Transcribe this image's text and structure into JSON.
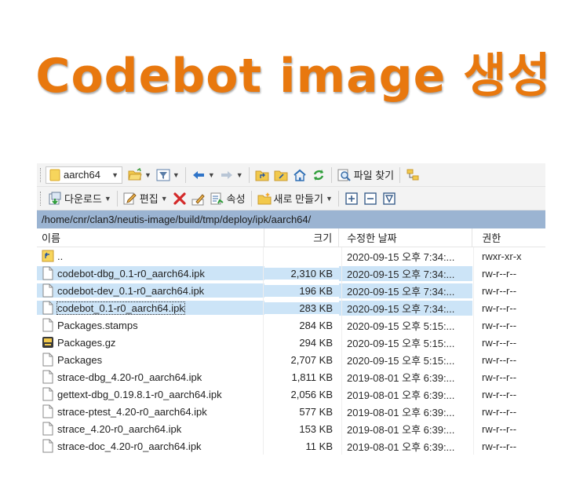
{
  "slide": {
    "title": "Codebot image 생성"
  },
  "toolbar1": {
    "folder": "aarch64",
    "find_files": "파일 찾기"
  },
  "toolbar2": {
    "download": "다운로드",
    "edit": "편집",
    "properties": "속성",
    "new": "새로 만들기"
  },
  "path": "/home/cnr/clan3/neutis-image/build/tmp/deploy/ipk/aarch64/",
  "columns": {
    "name": "이름",
    "size": "크기",
    "date": "수정한 날짜",
    "perm": "권한"
  },
  "files": [
    {
      "name": "..",
      "size": "",
      "date": "2020-09-15 오후 7:34:...",
      "perm": "rwxr-xr-x",
      "icon": "parent-dir-icon"
    },
    {
      "name": "codebot-dbg_0.1-r0_aarch64.ipk",
      "size": "2,310 KB",
      "date": "2020-09-15 오후 7:34:...",
      "perm": "rw-r--r--",
      "icon": "file-icon"
    },
    {
      "name": "codebot-dev_0.1-r0_aarch64.ipk",
      "size": "196 KB",
      "date": "2020-09-15 오후 7:34:...",
      "perm": "rw-r--r--",
      "icon": "file-icon"
    },
    {
      "name": "codebot_0.1-r0_aarch64.ipk",
      "size": "283 KB",
      "date": "2020-09-15 오후 7:34:...",
      "perm": "rw-r--r--",
      "icon": "file-icon"
    },
    {
      "name": "Packages.stamps",
      "size": "284 KB",
      "date": "2020-09-15 오후 5:15:...",
      "perm": "rw-r--r--",
      "icon": "file-icon"
    },
    {
      "name": "Packages.gz",
      "size": "294 KB",
      "date": "2020-09-15 오후 5:15:...",
      "perm": "rw-r--r--",
      "icon": "gz-archive-icon"
    },
    {
      "name": "Packages",
      "size": "2,707 KB",
      "date": "2020-09-15 오후 5:15:...",
      "perm": "rw-r--r--",
      "icon": "file-icon"
    },
    {
      "name": "strace-dbg_4.20-r0_aarch64.ipk",
      "size": "1,811 KB",
      "date": "2019-08-01 오후 6:39:...",
      "perm": "rw-r--r--",
      "icon": "file-icon"
    },
    {
      "name": "gettext-dbg_0.19.8.1-r0_aarch64.ipk",
      "size": "2,056 KB",
      "date": "2019-08-01 오후 6:39:...",
      "perm": "rw-r--r--",
      "icon": "file-icon"
    },
    {
      "name": "strace-ptest_4.20-r0_aarch64.ipk",
      "size": "577 KB",
      "date": "2019-08-01 오후 6:39:...",
      "perm": "rw-r--r--",
      "icon": "file-icon"
    },
    {
      "name": "strace_4.20-r0_aarch64.ipk",
      "size": "153 KB",
      "date": "2019-08-01 오후 6:39:...",
      "perm": "rw-r--r--",
      "icon": "file-icon"
    },
    {
      "name": "strace-doc_4.20-r0_aarch64.ipk",
      "size": "11 KB",
      "date": "2019-08-01 오후 6:39:...",
      "perm": "rw-r--r--",
      "icon": "file-icon"
    }
  ],
  "colors": {
    "title": "#e8780e",
    "pathbar": "#9bb4d2",
    "selection": "#cce4f7"
  }
}
